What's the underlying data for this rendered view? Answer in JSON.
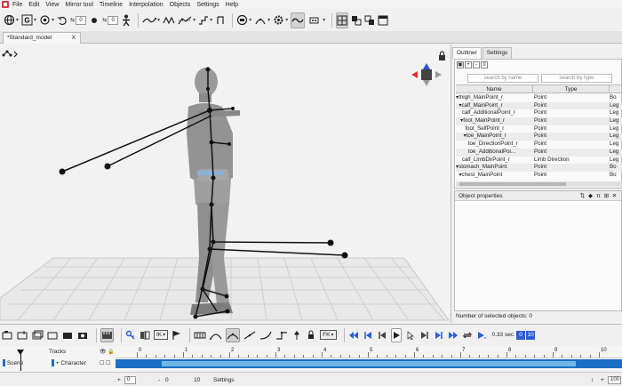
{
  "menu": [
    "File",
    "Edit",
    "View",
    "Mirror tool",
    "Timeline",
    "Interpolation",
    "Objects",
    "Settings",
    "Help"
  ],
  "toolbar": {
    "field_a": "0",
    "field_b": "0"
  },
  "tab": {
    "title": "*Standard_model",
    "close": "X"
  },
  "outliner": {
    "tabs": [
      "Outliner",
      "Settings"
    ],
    "tools": [
      "+",
      "-",
      "≡"
    ],
    "search_name": "search by name",
    "search_type": "search by type",
    "columns": [
      "Name",
      "Type",
      ""
    ],
    "rows": [
      {
        "name": "▾thigh_MainPoint_r",
        "type": "Point",
        "extra": "Bo"
      },
      {
        "name": "  ▾calf_MainPoint_r",
        "type": "Point",
        "extra": "Leg"
      },
      {
        "name": "    calf_AdditionalPoint_r",
        "type": "Point",
        "extra": "Leg"
      },
      {
        "name": "   ▾foot_MainPoint_r",
        "type": "Point",
        "extra": "Leg"
      },
      {
        "name": "      foot_SelfPoint_r",
        "type": "Point",
        "extra": "Leg"
      },
      {
        "name": "     ▾toe_MainPoint_r",
        "type": "Point",
        "extra": "Leg"
      },
      {
        "name": "        toe_DirectionPoint_r",
        "type": "Point",
        "extra": "Leg"
      },
      {
        "name": "        toe_AdditionalPoi...",
        "type": "Point",
        "extra": "Leg"
      },
      {
        "name": "    calf_LimbDirPoint_r",
        "type": "Limb Direction",
        "extra": "Leg"
      },
      {
        "name": "▾stomach_MainPoint",
        "type": "Point",
        "extra": "Bo"
      },
      {
        "name": "  ▾chest_MainPoint",
        "type": "Point",
        "extra": "Bo"
      }
    ]
  },
  "object_properties": {
    "title": "Object properties",
    "icons": [
      "⇅",
      "◆",
      "π",
      "⊞",
      "✕"
    ]
  },
  "selected_count": "Number of selected objects: 0",
  "timeline": {
    "fk_label": "FK",
    "ik_label": "IK",
    "time": "0.33 sec",
    "frame_a": "0",
    "frame_b": "10"
  },
  "tracks": {
    "label": "Tracks",
    "scene": "Scene",
    "character": "Character",
    "ruler": [
      "0",
      "1",
      "2",
      "3",
      "4",
      "5",
      "6",
      "7",
      "8",
      "9",
      "10"
    ]
  },
  "bottom": {
    "start": "0",
    "current": "0",
    "end": "10",
    "settings": "Settings",
    "zoom": "100"
  },
  "colors": {
    "accent": "#1b6fc4",
    "track_fill": "#6fb7e6",
    "gizmo_red": "#e03030",
    "gizmo_green": "#30b040",
    "gizmo_blue": "#3050e0"
  }
}
